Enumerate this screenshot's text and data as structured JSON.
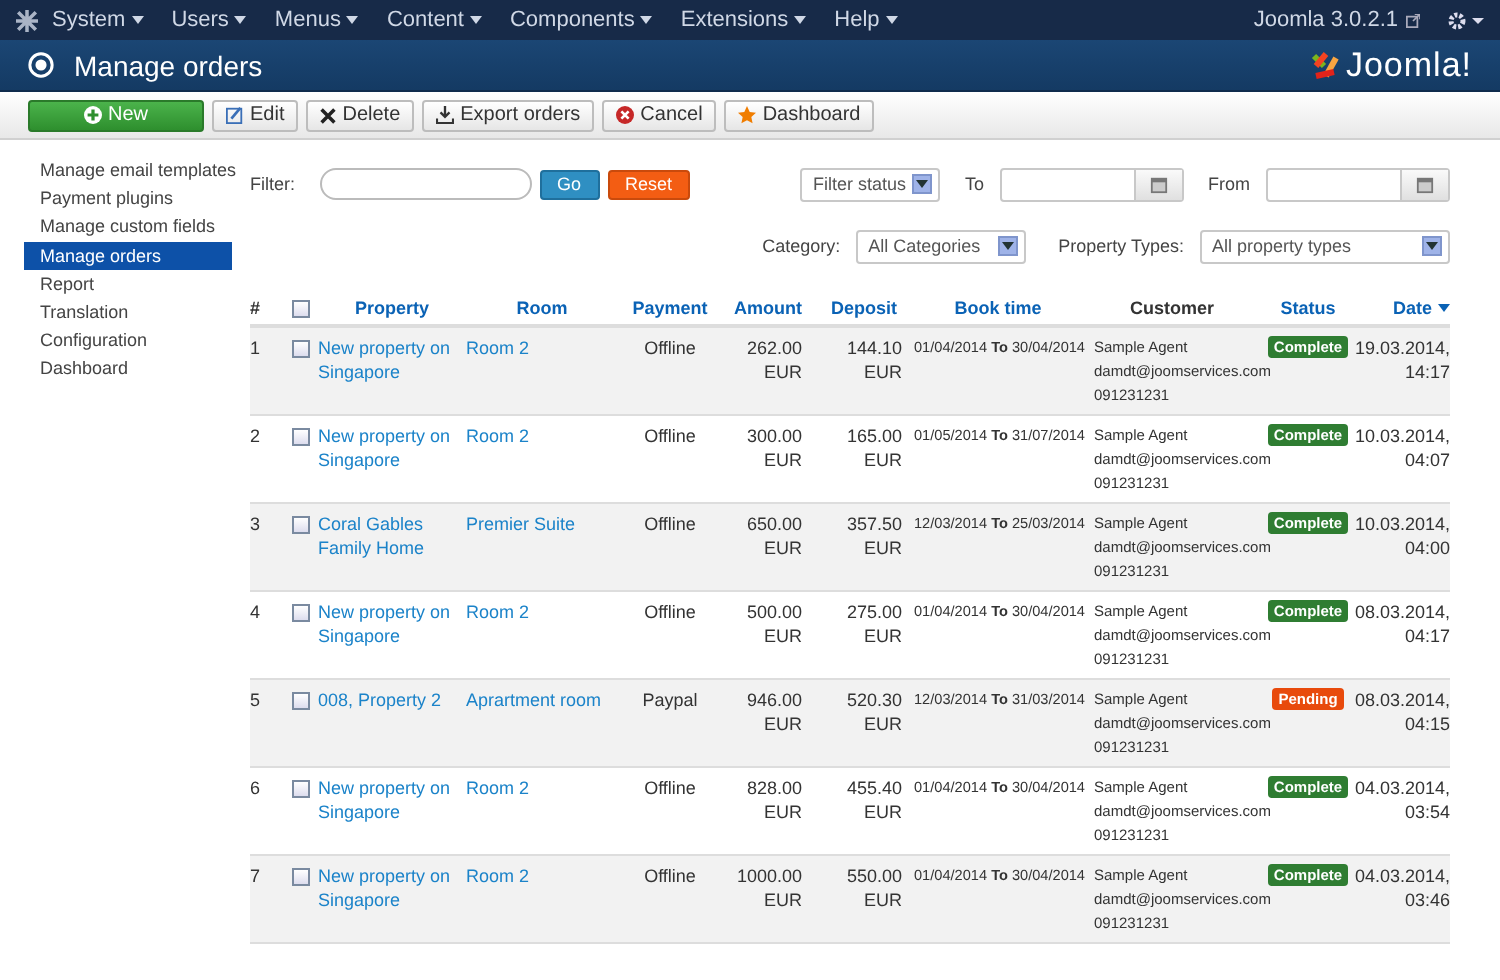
{
  "topbar": {
    "menus": [
      "System",
      "Users",
      "Menus",
      "Content",
      "Components",
      "Extensions",
      "Help"
    ],
    "version": "Joomla 3.0.2.1"
  },
  "header": {
    "title": "Manage orders",
    "logo": "Joomla!"
  },
  "toolbar": [
    {
      "label": "New",
      "kind": "new"
    },
    {
      "label": "Edit",
      "kind": "edit"
    },
    {
      "label": "Delete",
      "kind": "delete"
    },
    {
      "label": "Export orders",
      "kind": "export"
    },
    {
      "label": "Cancel",
      "kind": "cancel"
    },
    {
      "label": "Dashboard",
      "kind": "dashboard"
    }
  ],
  "sidebar": {
    "items": [
      {
        "label": "Manage email templates",
        "selected": false
      },
      {
        "label": "Payment plugins",
        "selected": false
      },
      {
        "label": "Manage custom fields",
        "selected": false
      },
      {
        "label": "Manage orders",
        "selected": true
      },
      {
        "label": "Report",
        "selected": false
      },
      {
        "label": "Translation",
        "selected": false
      },
      {
        "label": "Configuration",
        "selected": false
      },
      {
        "label": "Dashboard",
        "selected": false
      }
    ]
  },
  "filters": {
    "filter_label": "Filter:",
    "go": "Go",
    "reset": "Reset",
    "status_select": "Filter status",
    "to_label": "To",
    "from_label": "From",
    "category_label": "Category:",
    "category_select": "All Categories",
    "type_label": "Property Types:",
    "type_select": "All property types"
  },
  "table": {
    "columns": [
      {
        "label": "#",
        "kind": "plain"
      },
      {
        "kind": "check",
        "checked": false
      },
      {
        "label": "Property",
        "kind": "link"
      },
      {
        "label": "Room",
        "kind": "link"
      },
      {
        "label": "Payment",
        "kind": "link"
      },
      {
        "label": "Amount",
        "kind": "link"
      },
      {
        "label": "Deposit",
        "kind": "link"
      },
      {
        "label": "Book time",
        "kind": "link"
      },
      {
        "label": "Customer",
        "kind": "plain"
      },
      {
        "label": "Status",
        "kind": "link"
      },
      {
        "label": "Date",
        "kind": "sorted"
      }
    ],
    "rows": [
      {
        "num": "1",
        "checked": false,
        "property": "New property on Singapore",
        "room": "Room 2",
        "payment": "Offline",
        "amount": [
          "262.00",
          "EUR"
        ],
        "deposit": [
          "144.10",
          "EUR"
        ],
        "from": "01/04/2014",
        "to_word": "To",
        "to": "30/04/2014",
        "customer": [
          "Sample Agent",
          "damdt@joomservices.com",
          "091231231"
        ],
        "status": {
          "label": "Complete",
          "kind": "complete"
        },
        "date": [
          "19.03.2014,",
          "14:17"
        ]
      },
      {
        "num": "2",
        "checked": false,
        "property": "New property on Singapore",
        "room": "Room 2",
        "payment": "Offline",
        "amount": [
          "300.00",
          "EUR"
        ],
        "deposit": [
          "165.00",
          "EUR"
        ],
        "from": "01/05/2014",
        "to_word": "To",
        "to": "31/07/2014",
        "customer": [
          "Sample Agent",
          "damdt@joomservices.com",
          "091231231"
        ],
        "status": {
          "label": "Complete",
          "kind": "complete"
        },
        "date": [
          "10.03.2014,",
          "04:07"
        ]
      },
      {
        "num": "3",
        "checked": false,
        "property": "Coral Gables Family Home",
        "room": "Premier Suite",
        "payment": "Offline",
        "amount": [
          "650.00",
          "EUR"
        ],
        "deposit": [
          "357.50",
          "EUR"
        ],
        "from": "12/03/2014",
        "to_word": "To",
        "to": "25/03/2014",
        "customer": [
          "Sample Agent",
          "damdt@joomservices.com",
          "091231231"
        ],
        "status": {
          "label": "Complete",
          "kind": "complete"
        },
        "date": [
          "10.03.2014,",
          "04:00"
        ]
      },
      {
        "num": "4",
        "checked": false,
        "property": "New property on Singapore",
        "room": "Room 2",
        "payment": "Offline",
        "amount": [
          "500.00",
          "EUR"
        ],
        "deposit": [
          "275.00",
          "EUR"
        ],
        "from": "01/04/2014",
        "to_word": "To",
        "to": "30/04/2014",
        "customer": [
          "Sample Agent",
          "damdt@joomservices.com",
          "091231231"
        ],
        "status": {
          "label": "Complete",
          "kind": "complete"
        },
        "date": [
          "08.03.2014,",
          "04:17"
        ]
      },
      {
        "num": "5",
        "checked": false,
        "property": "008, Property 2",
        "room": "Aprartment room",
        "payment": "Paypal",
        "amount": [
          "946.00",
          "EUR"
        ],
        "deposit": [
          "520.30",
          "EUR"
        ],
        "from": "12/03/2014",
        "to_word": "To",
        "to": "31/03/2014",
        "customer": [
          "Sample Agent",
          "damdt@joomservices.com",
          "091231231"
        ],
        "status": {
          "label": "Pending",
          "kind": "pending"
        },
        "date": [
          "08.03.2014,",
          "04:15"
        ]
      },
      {
        "num": "6",
        "checked": false,
        "property": "New property on Singapore",
        "room": "Room 2",
        "payment": "Offline",
        "amount": [
          "828.00",
          "EUR"
        ],
        "deposit": [
          "455.40",
          "EUR"
        ],
        "from": "01/04/2014",
        "to_word": "To",
        "to": "30/04/2014",
        "customer": [
          "Sample Agent",
          "damdt@joomservices.com",
          "091231231"
        ],
        "status": {
          "label": "Complete",
          "kind": "complete"
        },
        "date": [
          "04.03.2014,",
          "03:54"
        ]
      },
      {
        "num": "7",
        "checked": false,
        "property": "New property on Singapore",
        "room": "Room 2",
        "payment": "Offline",
        "amount": [
          "1000.00",
          "EUR"
        ],
        "deposit": [
          "550.00",
          "EUR"
        ],
        "from": "01/04/2014",
        "to_word": "To",
        "to": "30/04/2014",
        "customer": [
          "Sample Agent",
          "damdt@joomservices.com",
          "091231231"
        ],
        "status": {
          "label": "Complete",
          "kind": "complete"
        },
        "date": [
          "04.03.2014,",
          "03:46"
        ]
      }
    ]
  }
}
